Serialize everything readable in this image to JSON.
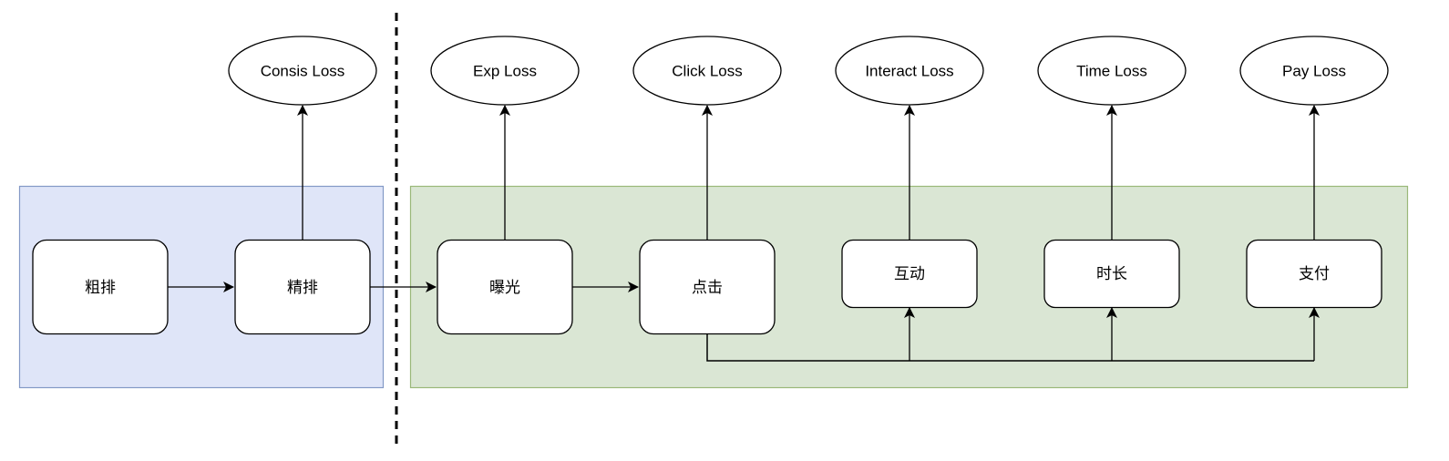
{
  "diagram": {
    "groups": [
      {
        "id": "coarse-group",
        "fill": "#dfe5f8",
        "stroke": "#8399c6"
      },
      {
        "id": "fine-group",
        "fill": "#dae6d4",
        "stroke": "#9ab879"
      }
    ],
    "nodes": {
      "coarse_rank": "粗排",
      "fine_rank": "精排",
      "exposure": "曝光",
      "click": "点击",
      "interact": "互动",
      "duration": "时长",
      "pay": "支付"
    },
    "losses": {
      "consis": "Consis Loss",
      "exp": "Exp Loss",
      "click": "Click Loss",
      "interact": "Interact Loss",
      "time": "Time Loss",
      "pay": "Pay Loss"
    },
    "edges": [
      {
        "from": "粗排",
        "to": "精排"
      },
      {
        "from": "精排",
        "to": "曝光"
      },
      {
        "from": "曝光",
        "to": "点击"
      },
      {
        "from": "点击",
        "to": "互动"
      },
      {
        "from": "点击",
        "to": "时长"
      },
      {
        "from": "点击",
        "to": "支付"
      },
      {
        "from": "精排",
        "to": "Consis Loss"
      },
      {
        "from": "曝光",
        "to": "Exp Loss"
      },
      {
        "from": "点击",
        "to": "Click Loss"
      },
      {
        "from": "互动",
        "to": "Interact Loss"
      },
      {
        "from": "时长",
        "to": "Time Loss"
      },
      {
        "from": "支付",
        "to": "Pay Loss"
      }
    ]
  }
}
